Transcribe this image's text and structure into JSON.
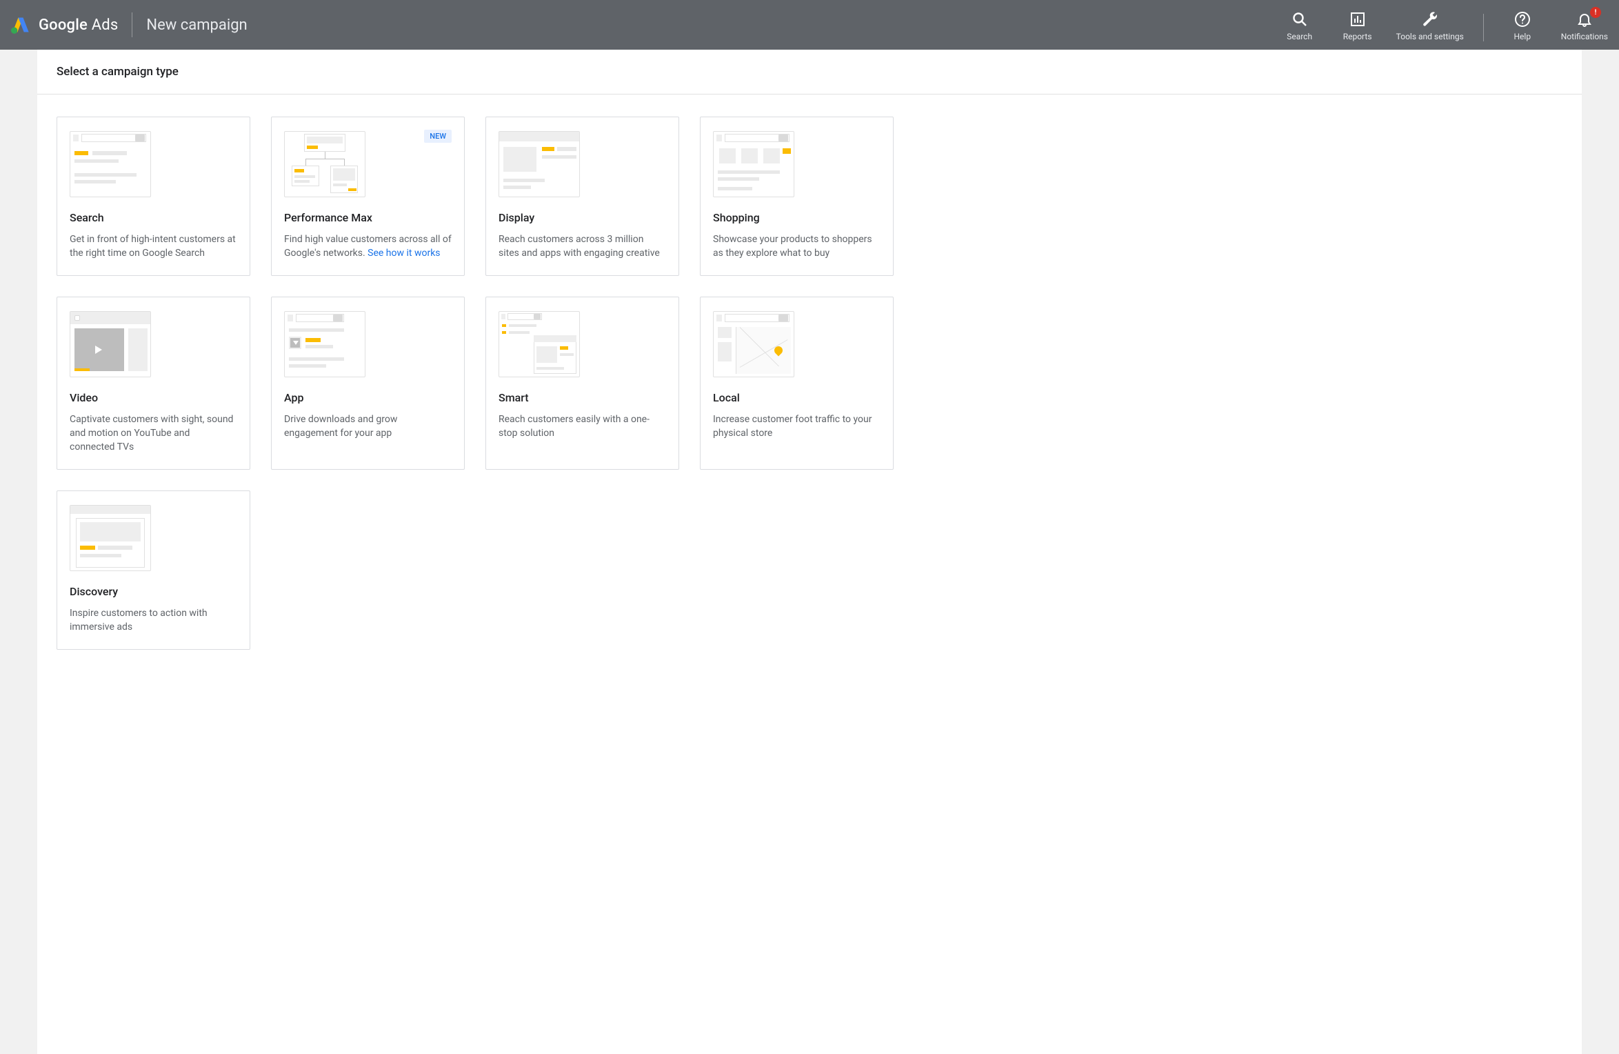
{
  "header": {
    "product": "Google",
    "product_suffix": "Ads",
    "page_title": "New campaign",
    "actions": {
      "search": "Search",
      "reports": "Reports",
      "tools": "Tools and settings",
      "help": "Help",
      "notifications": "Notifications",
      "notif_badge": "!"
    }
  },
  "section": {
    "title": "Select a campaign type"
  },
  "cards": {
    "search": {
      "title": "Search",
      "desc": "Get in front of high-intent customers at the right time on Google Search"
    },
    "pmax": {
      "badge": "NEW",
      "title": "Performance Max",
      "desc_prefix": "Find high value customers across all of Google's networks. ",
      "link": "See how it works"
    },
    "display": {
      "title": "Display",
      "desc": "Reach customers across 3 million sites and apps with engaging creative"
    },
    "shopping": {
      "title": "Shopping",
      "desc": "Showcase your products to shoppers as they explore what to buy"
    },
    "video": {
      "title": "Video",
      "desc": "Captivate customers with sight, sound and motion on YouTube and connected TVs"
    },
    "app": {
      "title": "App",
      "desc": "Drive downloads and grow engagement for your app"
    },
    "smart": {
      "title": "Smart",
      "desc": "Reach customers easily with a one-stop solution"
    },
    "local": {
      "title": "Local",
      "desc": "Increase customer foot traffic to your physical store"
    },
    "discovery": {
      "title": "Discovery",
      "desc": "Inspire customers to action with immersive ads"
    }
  }
}
